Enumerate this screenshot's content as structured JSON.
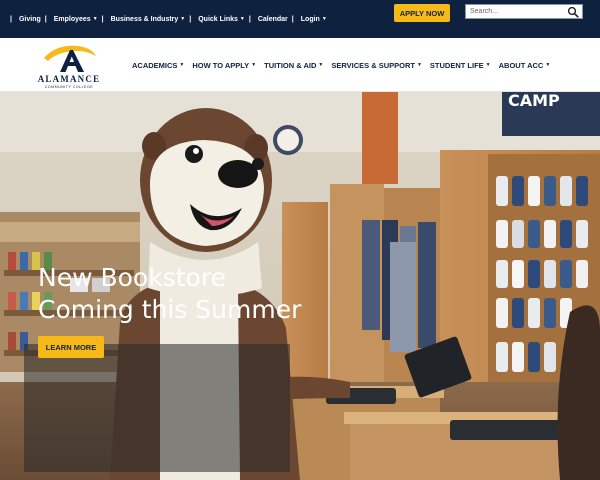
{
  "utility_bar": {
    "links": [
      {
        "label": "Giving",
        "dropdown": false
      },
      {
        "label": "Employees",
        "dropdown": true
      },
      {
        "label": "Business & Industry",
        "dropdown": true
      },
      {
        "label": "Quick Links",
        "dropdown": true
      },
      {
        "label": "Calendar",
        "dropdown": false
      },
      {
        "label": "Login",
        "dropdown": true
      }
    ],
    "apply_label": "APPLY NOW",
    "search_placeholder": "Search..."
  },
  "logo": {
    "name": "ALAMANCE",
    "tagline": "COMMUNITY COLLEGE"
  },
  "main_nav": [
    {
      "label": "ACADEMICS"
    },
    {
      "label": "HOW TO APPLY"
    },
    {
      "label": "TUITION & AID"
    },
    {
      "label": "SERVICES & SUPPORT"
    },
    {
      "label": "STUDENT LIFE"
    },
    {
      "label": "ABOUT ACC"
    }
  ],
  "hero": {
    "title_line1": "New Bookstore",
    "title_line2": "Coming this Summer",
    "cta_label": "LEARN MORE",
    "sign_text": "CAMP"
  },
  "colors": {
    "navy": "#0e2240",
    "gold": "#f7b918"
  }
}
